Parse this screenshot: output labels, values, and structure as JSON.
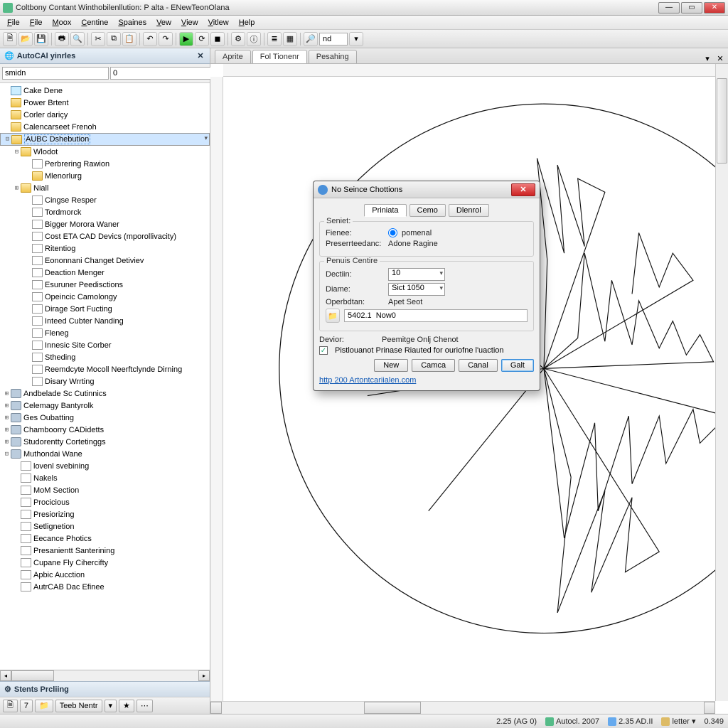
{
  "titlebar": "Coltbony Contant Winthobilenllution: P alta - ENewTeonOlana",
  "menu": [
    "File",
    "File",
    "Moox",
    "Centine",
    "Spaines",
    "Vew",
    "View",
    "Vitlew",
    "Help"
  ],
  "sidebar": {
    "title": "AutoCAl yinrles",
    "searchLabel": "smidn",
    "searchVal": "0",
    "items": [
      {
        "lvl": 0,
        "tw": "",
        "ic": "dia",
        "t": "Cake Dene"
      },
      {
        "lvl": 0,
        "tw": "",
        "ic": "fld",
        "t": "Power Brtent"
      },
      {
        "lvl": 0,
        "tw": "",
        "ic": "fld",
        "t": "Corler dariçy"
      },
      {
        "lvl": 0,
        "tw": "",
        "ic": "fld",
        "t": "Calencarseet Frenoh"
      },
      {
        "lvl": 0,
        "tw": "-",
        "ic": "fld",
        "t": "AUBC Dshebution",
        "sel": true
      },
      {
        "lvl": 1,
        "tw": "-",
        "ic": "fld",
        "t": "Wlodot"
      },
      {
        "lvl": 2,
        "tw": "",
        "ic": "doc",
        "t": "Perbrering Rawion"
      },
      {
        "lvl": 2,
        "tw": "",
        "ic": "fld",
        "t": "Mlenorlurg"
      },
      {
        "lvl": 1,
        "tw": "+",
        "ic": "fld",
        "t": "Niall"
      },
      {
        "lvl": 2,
        "tw": "",
        "ic": "doc",
        "t": "Cingse Resper"
      },
      {
        "lvl": 2,
        "tw": "",
        "ic": "doc",
        "t": "Tordmorck"
      },
      {
        "lvl": 2,
        "tw": "",
        "ic": "doc",
        "t": "Bigger Morora Waner"
      },
      {
        "lvl": 2,
        "tw": "",
        "ic": "doc",
        "t": "Cost ETA CAD Devics (mporollivacity)"
      },
      {
        "lvl": 2,
        "tw": "",
        "ic": "doc",
        "t": "Ritentiog"
      },
      {
        "lvl": 2,
        "tw": "",
        "ic": "doc",
        "t": "Eononnani Changet Detiviev"
      },
      {
        "lvl": 2,
        "tw": "",
        "ic": "doc",
        "t": "Deaction Menger"
      },
      {
        "lvl": 2,
        "tw": "",
        "ic": "doc",
        "t": "Esuruner Peedisctions"
      },
      {
        "lvl": 2,
        "tw": "",
        "ic": "doc",
        "t": "Opeincic Camolongy"
      },
      {
        "lvl": 2,
        "tw": "",
        "ic": "doc",
        "t": "Dirage Sort Fucting"
      },
      {
        "lvl": 2,
        "tw": "",
        "ic": "doc",
        "t": "Inteed Cubter Nanding"
      },
      {
        "lvl": 2,
        "tw": "",
        "ic": "doc",
        "t": "Fleneg"
      },
      {
        "lvl": 2,
        "tw": "",
        "ic": "doc",
        "t": "Innesic Site Corber"
      },
      {
        "lvl": 2,
        "tw": "",
        "ic": "doc",
        "t": "Stheding"
      },
      {
        "lvl": 2,
        "tw": "",
        "ic": "doc",
        "t": "Reemdcyte Mocoll Neerftclynde Dirning"
      },
      {
        "lvl": 2,
        "tw": "",
        "ic": "doc",
        "t": "Disary Wrrting"
      },
      {
        "lvl": 0,
        "tw": "+",
        "ic": "db",
        "t": "Andbelade Sc Cutinnics"
      },
      {
        "lvl": 0,
        "tw": "+",
        "ic": "db",
        "t": "Celemagy Bantyrolk"
      },
      {
        "lvl": 0,
        "tw": "+",
        "ic": "db",
        "t": "Ges Oubatting"
      },
      {
        "lvl": 0,
        "tw": "+",
        "ic": "db",
        "t": "Chamboorry CADidetts"
      },
      {
        "lvl": 0,
        "tw": "+",
        "ic": "db",
        "t": "Studorentty Cortetinggs"
      },
      {
        "lvl": 0,
        "tw": "-",
        "ic": "db",
        "t": "Muthondai Wane"
      },
      {
        "lvl": 1,
        "tw": "",
        "ic": "doc",
        "t": "lovenl svebining"
      },
      {
        "lvl": 1,
        "tw": "",
        "ic": "doc",
        "t": "Nakels"
      },
      {
        "lvl": 1,
        "tw": "",
        "ic": "doc",
        "t": "MoM Section"
      },
      {
        "lvl": 1,
        "tw": "",
        "ic": "doc",
        "t": "Procicious"
      },
      {
        "lvl": 1,
        "tw": "",
        "ic": "doc",
        "t": "Presiorizing"
      },
      {
        "lvl": 1,
        "tw": "",
        "ic": "doc",
        "t": "Setlignetion"
      },
      {
        "lvl": 1,
        "tw": "",
        "ic": "doc",
        "t": "Eecance Photics"
      },
      {
        "lvl": 1,
        "tw": "",
        "ic": "doc",
        "t": "Presanientt Santerining"
      },
      {
        "lvl": 1,
        "tw": "",
        "ic": "doc",
        "t": "Cupane Fly Cihercifty"
      },
      {
        "lvl": 1,
        "tw": "",
        "ic": "doc",
        "t": "Apbic Aucction"
      },
      {
        "lvl": 1,
        "tw": "",
        "ic": "doc",
        "t": "AutrCAB Dac Efinee"
      }
    ],
    "footer": "Stents Prcliing",
    "footerBtn": "Teeb Nentr"
  },
  "tabs": [
    "Aprite",
    "Fol  Tionenr",
    "Pesahing"
  ],
  "activeTab": 1,
  "dialog": {
    "title": "No Seince Chottions",
    "tabs": [
      "Priniata",
      "Cemo",
      "Dlenrol"
    ],
    "group1": "Seniet:",
    "f1l": "Fienee:",
    "f1v": "pomenal",
    "f2l": "Preserrteedanc:",
    "f2v": "Adone Ragine",
    "group2": "Penuis Centire",
    "f3l": "Dectiin:",
    "f3v": "10",
    "f4l": "Diame:",
    "f4v": "Sict 1050",
    "f5l": "Operbdtan:",
    "f5v": "Apet Seot",
    "pathVal": "5402.1  Now0",
    "devLab": "Devior:",
    "devVal": "Peemitge Onlj Chenot",
    "chk": "Pistlouanot Prinase Riauted for ouriofne l'uaction",
    "buttons": [
      "New",
      "Camca",
      "Canal",
      "Galt"
    ],
    "link": "http 200 Artontcariialen.com"
  },
  "prev7": "7",
  "status": {
    "coord": "2.25 (AG 0)",
    "app": "Autocl. 2007",
    "ver": "2.35 AD.II",
    "mode": "letter",
    "zoom": "0.349"
  }
}
